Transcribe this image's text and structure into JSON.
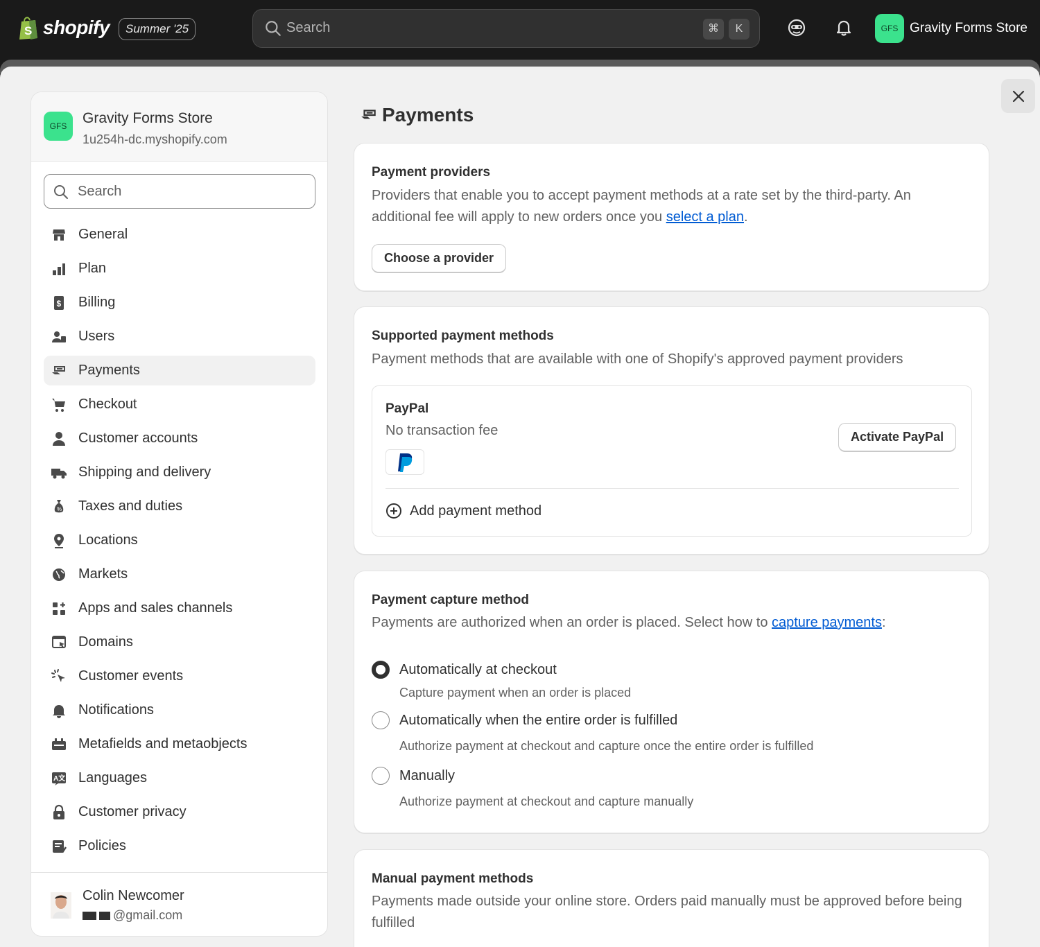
{
  "topbar": {
    "brand": "shopify",
    "edition": "Summer '25",
    "search_placeholder": "Search",
    "shortcut_keys": [
      "⌘",
      "K"
    ],
    "store_initials": "GFS",
    "store_name": "Gravity Forms Store"
  },
  "sidebar": {
    "store_initials": "GFS",
    "store_name": "Gravity Forms Store",
    "store_domain": "1u254h-dc.myshopify.com",
    "search_placeholder": "Search",
    "items": [
      {
        "label": "General",
        "icon": "store-icon",
        "active": false
      },
      {
        "label": "Plan",
        "icon": "plan-icon",
        "active": false
      },
      {
        "label": "Billing",
        "icon": "billing-icon",
        "active": false
      },
      {
        "label": "Users",
        "icon": "users-icon",
        "active": false
      },
      {
        "label": "Payments",
        "icon": "payments-icon",
        "active": true
      },
      {
        "label": "Checkout",
        "icon": "cart-icon",
        "active": false
      },
      {
        "label": "Customer accounts",
        "icon": "person-icon",
        "active": false
      },
      {
        "label": "Shipping and delivery",
        "icon": "truck-icon",
        "active": false
      },
      {
        "label": "Taxes and duties",
        "icon": "tax-icon",
        "active": false
      },
      {
        "label": "Locations",
        "icon": "location-pin-icon",
        "active": false
      },
      {
        "label": "Markets",
        "icon": "globe-icon",
        "active": false
      },
      {
        "label": "Apps and sales channels",
        "icon": "apps-icon",
        "active": false
      },
      {
        "label": "Domains",
        "icon": "domain-icon",
        "active": false
      },
      {
        "label": "Customer events",
        "icon": "cursor-click-icon",
        "active": false
      },
      {
        "label": "Notifications",
        "icon": "bell-icon",
        "active": false
      },
      {
        "label": "Metafields and metaobjects",
        "icon": "metafields-icon",
        "active": false
      },
      {
        "label": "Languages",
        "icon": "translate-icon",
        "active": false
      },
      {
        "label": "Customer privacy",
        "icon": "lock-icon",
        "active": false
      },
      {
        "label": "Policies",
        "icon": "policy-icon",
        "active": false
      }
    ],
    "user": {
      "name": "Colin Newcomer",
      "email_suffix": "@gmail.com"
    }
  },
  "main": {
    "title": "Payments",
    "providers": {
      "heading": "Payment providers",
      "desc_before": "Providers that enable you to accept payment methods at a rate set by the third-party. An additional fee will apply to new orders once you ",
      "desc_link": "select a plan",
      "desc_after": ".",
      "button": "Choose a provider"
    },
    "supported": {
      "heading": "Supported payment methods",
      "desc": "Payment methods that are available with one of Shopify's approved payment providers",
      "provider_name": "PayPal",
      "provider_fee": "No transaction fee",
      "activate_button": "Activate PayPal",
      "add_method": "Add payment method"
    },
    "capture": {
      "heading": "Payment capture method",
      "desc_before": "Payments are authorized when an order is placed. Select how to ",
      "desc_link": "capture payments",
      "desc_after": ":",
      "options": [
        {
          "label": "Automatically at checkout",
          "help": "Capture payment when an order is placed",
          "checked": true
        },
        {
          "label": "Automatically when the entire order is fulfilled",
          "help": "Authorize payment at checkout and capture once the entire order is fulfilled",
          "checked": false
        },
        {
          "label": "Manually",
          "help": "Authorize payment at checkout and capture manually",
          "checked": false
        }
      ]
    },
    "manual": {
      "heading": "Manual payment methods",
      "desc": "Payments made outside your online store. Orders paid manually must be approved before being fulfilled"
    }
  },
  "colors": {
    "accent_green": "#3be28d",
    "link_blue": "#005bd3",
    "topbar_bg": "#1a1a1a"
  }
}
